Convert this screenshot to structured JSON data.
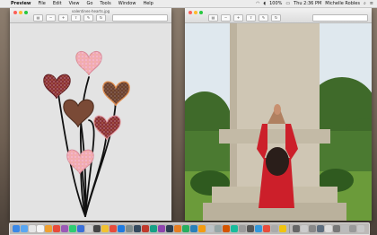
{
  "menubar": {
    "apple_glyph": "",
    "items": [
      "Preview",
      "File",
      "Edit",
      "View",
      "Go",
      "Tools",
      "Window",
      "Help"
    ],
    "battery": "100%",
    "clock": "Thu 2:36 PM",
    "user": "Michelle Robles"
  },
  "left_window": {
    "title": "valentines-hearts.jpg"
  },
  "right_window": {
    "title": ""
  },
  "colors": {
    "heart_dark": "#8a2f36",
    "heart_pink": "#f1a8b6",
    "heart_brown": "#6b4030",
    "shirt_red": "#cc1f2a",
    "stone": "#cfc6b4",
    "foliage": "#3f6a2a",
    "sky": "#dfe8ee"
  },
  "dock": {
    "icon_colors": [
      "#3a88e6",
      "#5aa7f2",
      "#e6e6e6",
      "#f5f5f5",
      "#f0a030",
      "#e84a3a",
      "#9b59b6",
      "#2ecc71",
      "#3a6fd8",
      "#d0d0d0",
      "#444444",
      "#f2c230",
      "#e74c3c",
      "#1f7ae0",
      "#7f8c8d",
      "#34495e",
      "#c0392b",
      "#16a085",
      "#8e44ad",
      "#2c3e50",
      "#e67e22",
      "#27ae60",
      "#2980b9",
      "#f39c12",
      "#bdc3c7",
      "#95a5a6",
      "#d35400",
      "#1abc9c",
      "#9b9b9b",
      "#555555",
      "#3498db",
      "#e74c3c",
      "#aaaaaa",
      "#f1c40f",
      "#666666",
      "#cccccc",
      "#888888",
      "#5d6d7e",
      "#dddddd",
      "#777777",
      "#bbbbbb",
      "#999999",
      "#c7c7c7"
    ]
  }
}
